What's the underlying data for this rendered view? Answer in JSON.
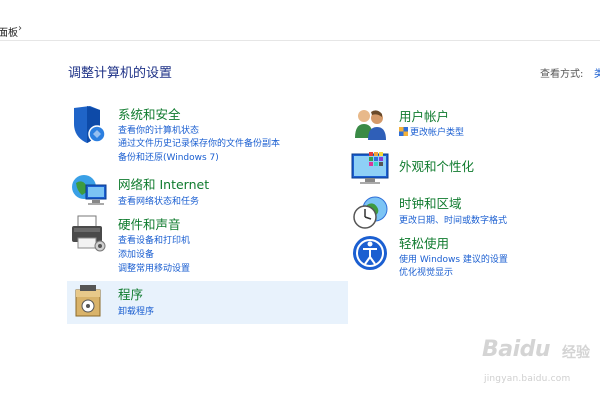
{
  "breadcrumb": {
    "current": "面板",
    "separator": "›"
  },
  "page_title": "调整计算机的设置",
  "view_by": {
    "label": "查看方式:",
    "value": "类"
  },
  "categories": {
    "system_security": {
      "title": "系统和安全",
      "links": [
        "查看你的计算机状态",
        "通过文件历史记录保存你的文件备份副本",
        "备份和还原(Windows 7)"
      ]
    },
    "network": {
      "title": "网络和 Internet",
      "links": [
        "查看网络状态和任务"
      ]
    },
    "hardware": {
      "title": "硬件和声音",
      "links": [
        "查看设备和打印机",
        "添加设备",
        "调整常用移动设置"
      ]
    },
    "programs": {
      "title": "程序",
      "links": [
        "卸载程序"
      ]
    },
    "user_accounts": {
      "title": "用户帐户",
      "links": [
        "更改帐户类型"
      ]
    },
    "appearance": {
      "title": "外观和个性化",
      "links": []
    },
    "clock_region": {
      "title": "时钟和区域",
      "links": [
        "更改日期、时间或数字格式"
      ]
    },
    "ease_access": {
      "title": "轻松使用",
      "links": [
        "使用 Windows 建议的设置",
        "优化视觉显示"
      ]
    }
  },
  "watermark": {
    "logo": "Baidu",
    "text": "经验",
    "url": "jingyan.baidu.com"
  },
  "colors": {
    "title_blue": "#1e3287",
    "category_green": "#0f7b2e",
    "link_blue": "#1b5fd1",
    "highlight": "#e8f2fc"
  }
}
